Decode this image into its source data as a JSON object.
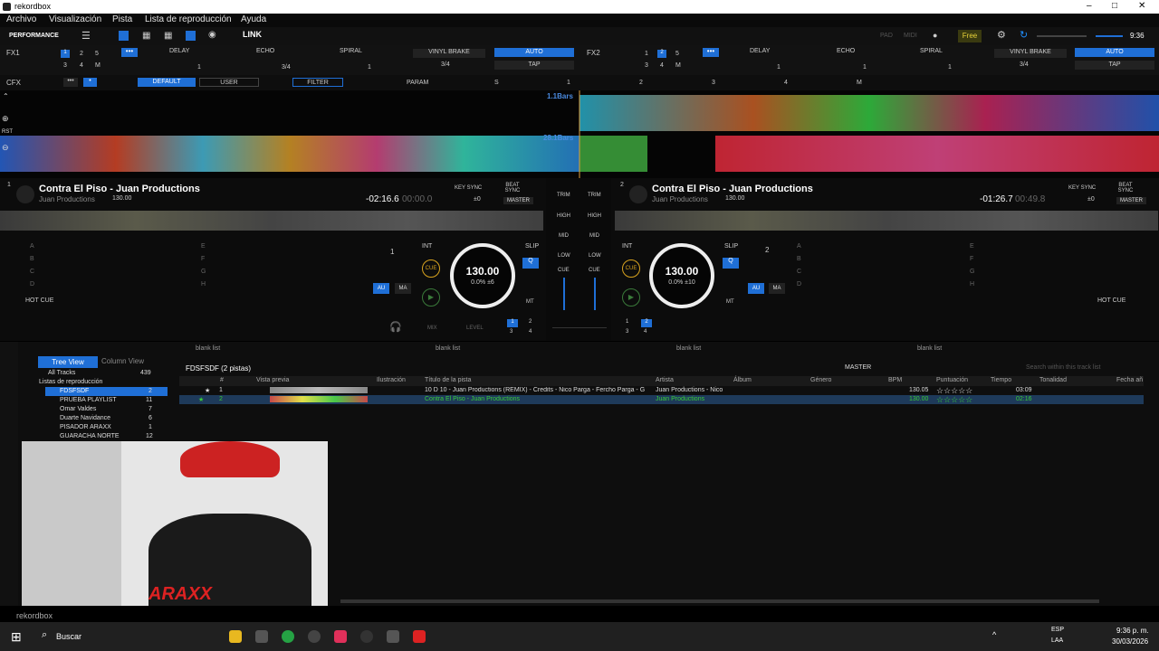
{
  "window": {
    "title": "rekordbox",
    "controls": [
      "–",
      "□",
      "✕"
    ]
  },
  "menu": [
    "Archivo",
    "Visualización",
    "Pista",
    "Lista de reproducción",
    "Ayuda"
  ],
  "topbar": {
    "mode": "PERFORMANCE",
    "link": "LINK",
    "pad": "PAD",
    "midi": "MIDI",
    "plan": "Free",
    "time": "9:36"
  },
  "fx1": {
    "label": "FX1",
    "nums": [
      "1",
      "2",
      "5",
      "3",
      "4",
      "M"
    ],
    "effects": [
      "DELAY",
      "ECHO",
      "SPIRAL",
      "VINYL BRAKE"
    ],
    "auto": "AUTO",
    "tap": "TAP",
    "beat": "3/4",
    "val1": "1",
    "val2": "1"
  },
  "fx2": {
    "label": "FX2",
    "nums": [
      "1",
      "2",
      "5",
      "3",
      "4",
      "M"
    ],
    "effects": [
      "DELAY",
      "ECHO",
      "SPIRAL",
      "VINYL BRAKE"
    ],
    "auto": "AUTO",
    "tap": "TAP",
    "beat": "3/4",
    "val1": "1",
    "val2": "1"
  },
  "cfx": {
    "label": "CFX",
    "default": "DEFAULT",
    "user": "USER",
    "filter": "FILTER",
    "param": "PARAM",
    "s": "S",
    "n1": "1",
    "n2": "2",
    "n3": "3",
    "n4": "4",
    "m": "M"
  },
  "waveform": {
    "bars_top": "1.1Bars",
    "bars_bottom": "28.1Bars",
    "rst": "RST"
  },
  "deck1": {
    "num": "1",
    "title": "Contra El Piso - Juan Productions",
    "artist": "Juan Productions",
    "bpm_small": "130.00",
    "remain": "-02:16.6",
    "elapsed": "00:00.0",
    "key_sync": "KEY SYNC",
    "beat_sync": "BEAT SYNC",
    "master": "MASTER",
    "pm": "±0",
    "hotcue": "HOT CUE",
    "pads_left": [
      "A",
      "B",
      "C",
      "D"
    ],
    "pads_right": [
      "E",
      "F",
      "G",
      "H"
    ],
    "beatnum": "1",
    "int": "INT",
    "slip": "SLIP",
    "q": "Q",
    "au": "AU",
    "ma": "MA",
    "mt": "MT",
    "cue": "CUE",
    "bpm": "130.00",
    "pct": "0.0% ±6"
  },
  "deck2": {
    "num": "2",
    "title": "Contra El Piso - Juan Productions",
    "artist": "Juan Productions",
    "bpm_small": "130.00",
    "remain": "-01:26.7",
    "elapsed": "00:49.8",
    "key_sync": "KEY SYNC",
    "beat_sync": "BEAT SYNC",
    "master": "MASTER",
    "pm": "±0",
    "hotcue": "HOT CUE",
    "pads_left": [
      "A",
      "B",
      "C",
      "D"
    ],
    "pads_right": [
      "E",
      "F",
      "G",
      "H"
    ],
    "beatnum": "2",
    "int": "INT",
    "slip": "SLIP",
    "q": "Q",
    "au": "AU",
    "ma": "MA",
    "mt": "MT",
    "cue": "CUE",
    "bpm": "130.00",
    "pct": "0.0% ±10"
  },
  "mixer": {
    "trim": "TRIM",
    "high": "HIGH",
    "mid": "MID",
    "low": "LOW",
    "cue": "CUE",
    "mix": "MIX",
    "level": "LEVEL",
    "n1": "1",
    "n2": "2",
    "n3": "3",
    "n4": "4"
  },
  "browser": {
    "blank": [
      "blank list",
      "blank list",
      "blank list",
      "blank list"
    ],
    "tree_view": "Tree View",
    "column_view": "Column View",
    "all_tracks": "All Tracks",
    "all_tracks_count": "439",
    "playlists_header": "Listas de reproducción",
    "playlists": [
      {
        "name": "FDSFSDF",
        "count": "2"
      },
      {
        "name": "PRUEBA PLAYLIST",
        "count": "11"
      },
      {
        "name": "Omar Valdes",
        "count": "7"
      },
      {
        "name": "Duarte Navidance",
        "count": "6"
      },
      {
        "name": "PISADOR ARAXX",
        "count": "1"
      },
      {
        "name": "GUARACHA NORTE",
        "count": "12"
      }
    ],
    "list_title": "FDSFSDF (2 pistas)",
    "master": "MASTER",
    "search_placeholder": "Search within this track list",
    "columns": [
      "#",
      "Vista previa",
      "Ilustración",
      "Título de la pista",
      "Artista",
      "Álbum",
      "Género",
      "BPM",
      "Puntuación",
      "Tiempo",
      "Tonalidad",
      "Fecha añ"
    ],
    "rows": [
      {
        "num": "1",
        "title": "10 D 10 - Juan Productions (REMIX) - Credits - Nico Parga - Fercho Parga - G",
        "artist": "Juan Productions - Nico",
        "bpm": "130.05",
        "rating": "☆☆☆☆☆",
        "time": "03:09"
      },
      {
        "num": "2",
        "title": "Contra El Piso - Juan Productions",
        "artist": "Juan Productions",
        "bpm": "130.00",
        "rating": "☆☆☆☆☆",
        "time": "02:16"
      }
    ]
  },
  "overlay": {
    "brand": "ARAXX",
    "rekordbox": "rekordbox"
  },
  "taskbar": {
    "search": "Buscar",
    "lang": "ESP",
    "lang2": "LAA",
    "time": "9:36 p. m.",
    "date": "30/03/2026"
  },
  "colors": {
    "accent": "#1f6fd6",
    "cue": "#d9a31e",
    "green": "#3acc3a"
  }
}
